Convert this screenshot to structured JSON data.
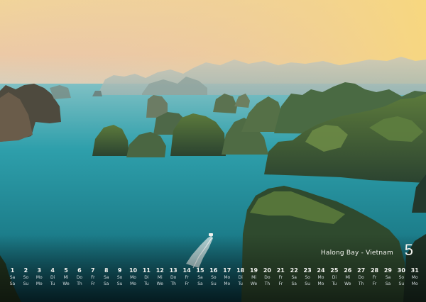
{
  "caption": {
    "title": "Halong Bay - Vietnam",
    "month_number": "5"
  },
  "calendar": {
    "days": [
      {
        "n": "1",
        "ab": "Sa/Sa",
        "w": false
      },
      {
        "n": "2",
        "ab": "So/Su",
        "w": true
      },
      {
        "n": "3",
        "ab": "Mo/Mo",
        "w": false
      },
      {
        "n": "4",
        "ab": "Di/Tu",
        "w": false
      },
      {
        "n": "5",
        "ab": "Mi/We",
        "w": false
      },
      {
        "n": "6",
        "ab": "Do/Th",
        "w": false
      },
      {
        "n": "7",
        "ab": "Fr/Fr",
        "w": false
      },
      {
        "n": "8",
        "ab": "Sa/Sa",
        "w": false
      },
      {
        "n": "9",
        "ab": "So/Su",
        "w": true
      },
      {
        "n": "10",
        "ab": "Mo/Mo",
        "w": false
      },
      {
        "n": "11",
        "ab": "Di/Tu",
        "w": false
      },
      {
        "n": "12",
        "ab": "Mi/We",
        "w": false
      },
      {
        "n": "13",
        "ab": "Do/Th",
        "w": false
      },
      {
        "n": "14",
        "ab": "Fr/Fr",
        "w": false
      },
      {
        "n": "15",
        "ab": "Sa/Sa",
        "w": false
      },
      {
        "n": "16",
        "ab": "So/Su",
        "w": true
      },
      {
        "n": "17",
        "ab": "Mo/Mo",
        "w": false
      },
      {
        "n": "18",
        "ab": "Di/Tu",
        "w": false
      },
      {
        "n": "19",
        "ab": "Mi/We",
        "w": false
      },
      {
        "n": "20",
        "ab": "Do/Th",
        "w": false
      },
      {
        "n": "21",
        "ab": "Fr/Fr",
        "w": false
      },
      {
        "n": "22",
        "ab": "Sa/Sa",
        "w": false
      },
      {
        "n": "23",
        "ab": "So/Su",
        "w": true
      },
      {
        "n": "24",
        "ab": "Mo/Mo",
        "w": false
      },
      {
        "n": "25",
        "ab": "Di/Tu",
        "w": false
      },
      {
        "n": "26",
        "ab": "Mi/We",
        "w": false
      },
      {
        "n": "27",
        "ab": "Do/Th",
        "w": false
      },
      {
        "n": "28",
        "ab": "Fr/Fr",
        "w": false
      },
      {
        "n": "29",
        "ab": "Sa/Sa",
        "w": false
      },
      {
        "n": "30",
        "ab": "So/Su",
        "w": true
      },
      {
        "n": "31",
        "ab": "Mo/Mo",
        "w": false
      }
    ]
  },
  "colors": {
    "sky_top": "#f7d98c",
    "sky_low": "#e9c9a8",
    "water": "#2aa3ad",
    "water_deep": "#0f5562",
    "karst": "#3c5f3a"
  }
}
